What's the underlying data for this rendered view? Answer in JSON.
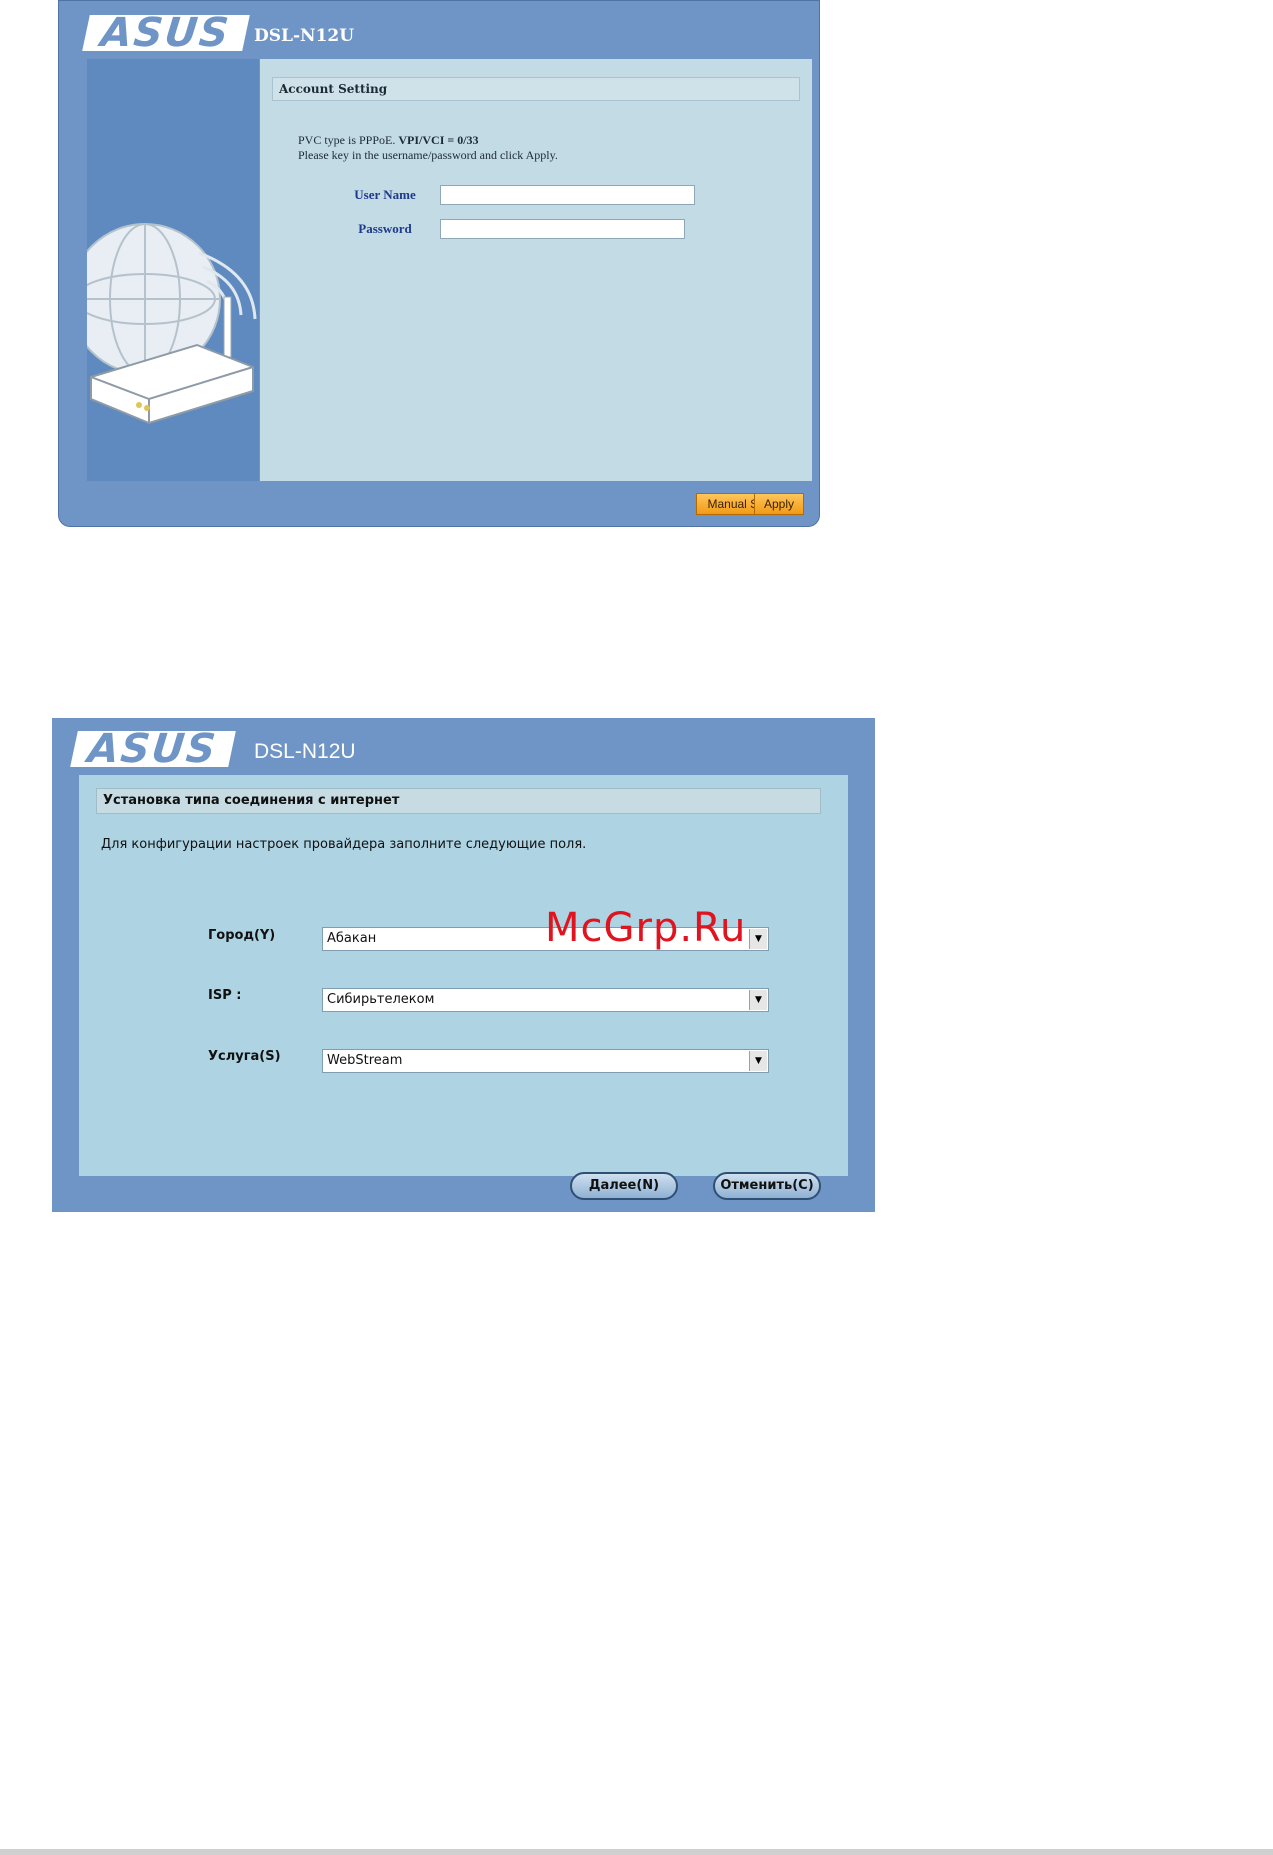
{
  "screen1": {
    "brand": "ASUS",
    "model": "DSL-N12U",
    "section_title": "Account Setting",
    "desc_line1_prefix": "PVC type is PPPoE. ",
    "desc_line1_bold": "VPI/VCI = 0/33",
    "desc_line2": "Please key in the username/password and click Apply.",
    "username_label": "User Name",
    "username_value": "",
    "password_label": "Password",
    "password_value": "",
    "manual_setting_label": "Manual Setting",
    "apply_label": "Apply"
  },
  "screen2": {
    "brand": "ASUS",
    "model": "DSL-N12U",
    "section_title": "Установка типа соединения с интернет",
    "desc": "Для конфигурации настроек провайдера заполните следующие поля.",
    "fields": [
      {
        "label": "Город(Y)",
        "value": "Абакан"
      },
      {
        "label": "ISP :",
        "value": "Сибирьтелеком"
      },
      {
        "label": "Услуга(S)",
        "value": "WebStream"
      }
    ],
    "next_label": "Далее(N)",
    "cancel_label": "Отменить(C)"
  },
  "watermark": "McGrp.Ru",
  "icons": {
    "globe": "globe-icon",
    "router": "router-icon",
    "wifi": "wifi-signal-icon",
    "dropdown": "chevron-down-icon"
  },
  "colors": {
    "frame_blue": "#6f95c6",
    "content_light_blue": "#c2dbe5",
    "button_orange": "#f29a16",
    "watermark_red": "#e0141e"
  }
}
